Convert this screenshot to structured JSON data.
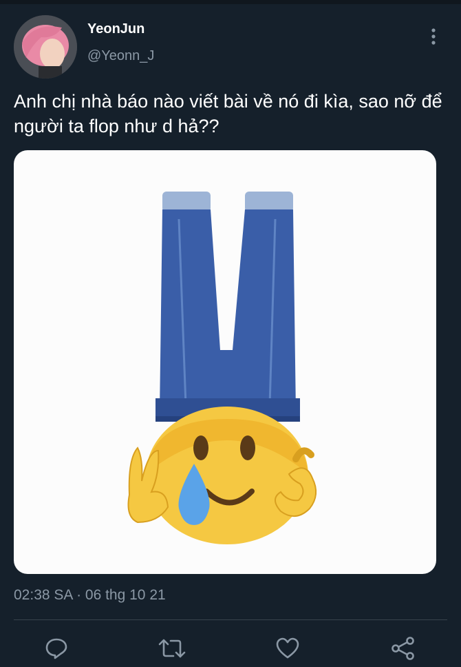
{
  "author": {
    "display_name": "YeonJun",
    "handle": "@Yeonn_J"
  },
  "tweet": {
    "text": "Anh chị nhà báo nào viết bài về nó đi kìa, sao nỡ để người ta flop như d hả??",
    "timestamp": "02:38 SA · 06 thg 10 21"
  },
  "media": {
    "description_icon": "upside-down-jeans-crying-emoji"
  },
  "actions": {
    "reply_icon": "reply-icon",
    "retweet_icon": "retweet-icon",
    "like_icon": "heart-icon",
    "share_icon": "share-icon"
  },
  "colors": {
    "background": "#15202b",
    "secondary_text": "#8b98a5",
    "divider": "#38444d"
  }
}
